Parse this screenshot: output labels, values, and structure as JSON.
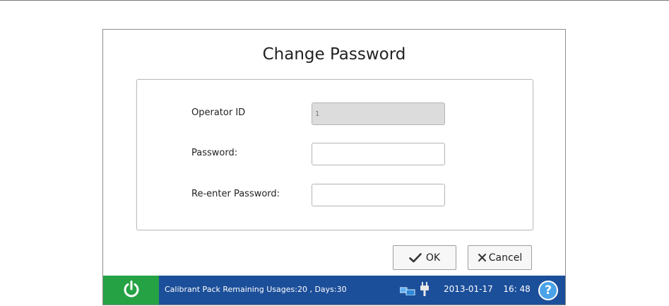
{
  "dialog": {
    "title": "Change Password"
  },
  "form": {
    "operator_id_label": "Operator ID",
    "operator_id_value": "1",
    "password_label": "Password:",
    "password_value": "",
    "reenter_label": "Re-enter Password:",
    "reenter_value": ""
  },
  "buttons": {
    "ok_label": "OK",
    "cancel_label": "Cancel"
  },
  "status_bar": {
    "message": "Calibrant Pack Remaining Usages:20 , Days:30",
    "date": "2013-01-17",
    "time": "16: 48",
    "help_glyph": "?",
    "icons": [
      "power-icon",
      "network-icon",
      "plug-icon",
      "help-icon"
    ]
  },
  "colors": {
    "status_bar": "#1c4f9a",
    "power_button": "#25a244",
    "help_button": "#4aa3e8"
  }
}
